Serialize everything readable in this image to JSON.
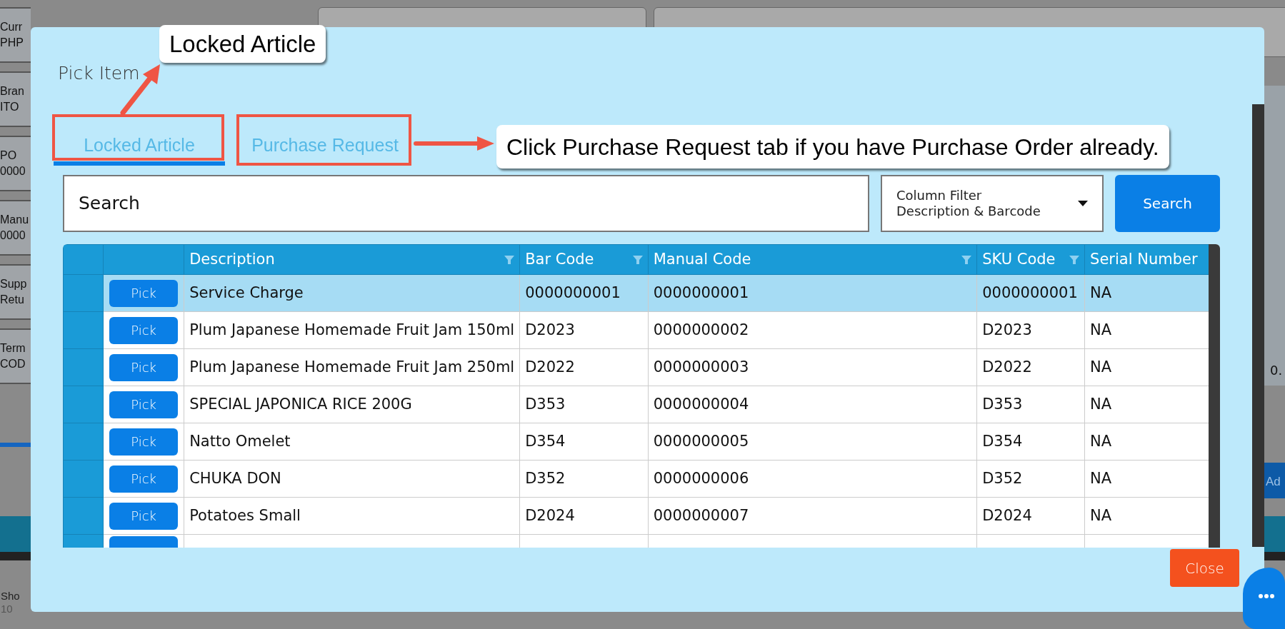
{
  "background": {
    "side_fields": [
      {
        "label": "Curr",
        "value": "PHP"
      },
      {
        "label": "Bran",
        "value": "ITO"
      },
      {
        "label": "PO",
        "value": "0000"
      },
      {
        "label": "Manu",
        "value": "0000"
      },
      {
        "label": "Supp",
        "value": "Retu"
      },
      {
        "label": "Term",
        "value": "COD"
      }
    ],
    "side_value": "0.",
    "add_button": "Ad",
    "show": {
      "label": "Sho",
      "value": "10"
    }
  },
  "modal": {
    "title": "Pick Item",
    "tabs": [
      {
        "label": "Locked Article",
        "selected": true
      },
      {
        "label": "Purchase Request",
        "selected": false
      }
    ],
    "search": {
      "placeholder": "Search"
    },
    "column_filter": {
      "label": "Column Filter",
      "value": "Description & Barcode"
    },
    "search_button": "Search",
    "table": {
      "columns": [
        {
          "label": "Description",
          "filter": true
        },
        {
          "label": "Bar Code",
          "filter": true
        },
        {
          "label": "Manual Code",
          "filter": true
        },
        {
          "label": "SKU Code",
          "filter": true
        },
        {
          "label": "Serial Number",
          "filter": false
        }
      ],
      "rows": [
        {
          "button": "Pick",
          "cells": [
            "Service Charge",
            "0000000001",
            "0000000001",
            "0000000001",
            "NA"
          ],
          "selected": true
        },
        {
          "button": "Pick",
          "cells": [
            "Plum Japanese Homemade Fruit Jam 150ml",
            "D2023",
            "0000000002",
            "D2023",
            "NA"
          ],
          "selected": false
        },
        {
          "button": "Pick",
          "cells": [
            "Plum Japanese Homemade Fruit Jam 250ml",
            "D2022",
            "0000000003",
            "D2022",
            "NA"
          ],
          "selected": false
        },
        {
          "button": "Pick",
          "cells": [
            "SPECIAL JAPONICA RICE 200G",
            "D353",
            "0000000004",
            "D353",
            "NA"
          ],
          "selected": false
        },
        {
          "button": "Pick",
          "cells": [
            "Natto Omelet",
            "D354",
            "0000000005",
            "D354",
            "NA"
          ],
          "selected": false
        },
        {
          "button": "Pick",
          "cells": [
            "CHUKA DON",
            "D352",
            "0000000006",
            "D352",
            "NA"
          ],
          "selected": false
        },
        {
          "button": "Pick",
          "cells": [
            "Potatoes Small",
            "D2024",
            "0000000007",
            "D2024",
            "NA"
          ],
          "selected": false
        }
      ]
    },
    "close_button": "Close"
  },
  "annotations": [
    "Locked Article",
    "Click Purchase Request tab if you have Purchase Order already."
  ]
}
